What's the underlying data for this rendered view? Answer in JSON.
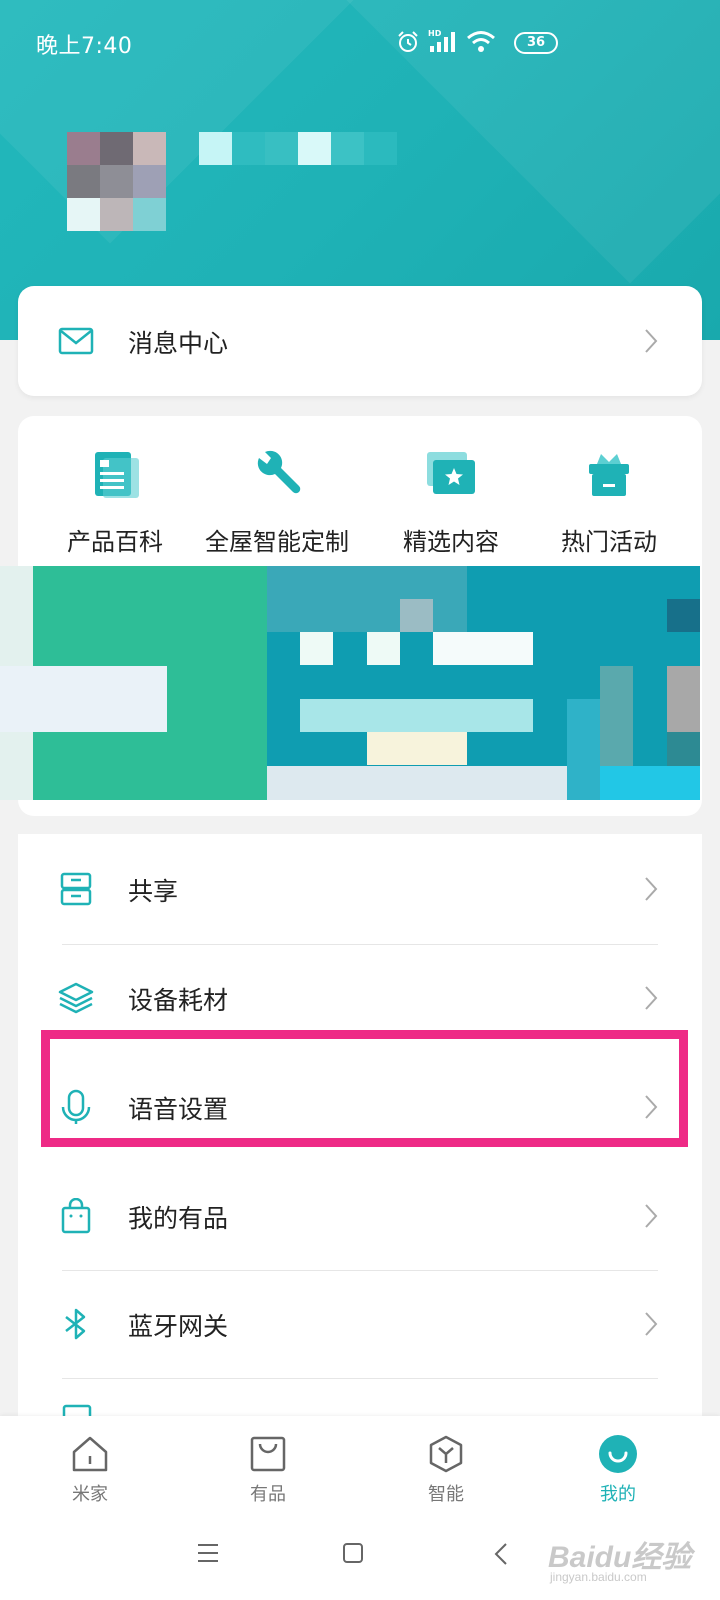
{
  "status_bar": {
    "time": "晚上7:40",
    "battery": "36",
    "icons": [
      "alarm-icon",
      "hd-signal-icon",
      "wifi-icon",
      "battery-icon"
    ]
  },
  "message_center": {
    "label": "消息中心",
    "icon": "mail-icon"
  },
  "quick_actions": [
    {
      "label": "产品百科",
      "icon": "document-icon"
    },
    {
      "label": "全屋智能定制",
      "icon": "wrench-icon"
    },
    {
      "label": "精选内容",
      "icon": "star-folder-icon"
    },
    {
      "label": "热门活动",
      "icon": "gift-icon"
    }
  ],
  "menu_items": [
    {
      "label": "共享",
      "icon": "share-drawer-icon"
    },
    {
      "label": "设备耗材",
      "icon": "layers-icon"
    },
    {
      "label": "语音设置",
      "icon": "microphone-icon"
    },
    {
      "label": "我的有品",
      "icon": "shopping-bag-icon"
    },
    {
      "label": "蓝牙网关",
      "icon": "bluetooth-icon"
    }
  ],
  "tabs": [
    {
      "label": "米家",
      "icon": "home-icon",
      "active": false
    },
    {
      "label": "有品",
      "icon": "bag-icon",
      "active": false
    },
    {
      "label": "智能",
      "icon": "smart-icon",
      "active": false
    },
    {
      "label": "我的",
      "icon": "profile-smile-icon",
      "active": true
    }
  ],
  "watermark": {
    "main": "Baidu经验",
    "sub": "jingyan.baidu.com"
  },
  "colors": {
    "accent": "#1fb2b6",
    "highlight": "#ee2a86"
  }
}
